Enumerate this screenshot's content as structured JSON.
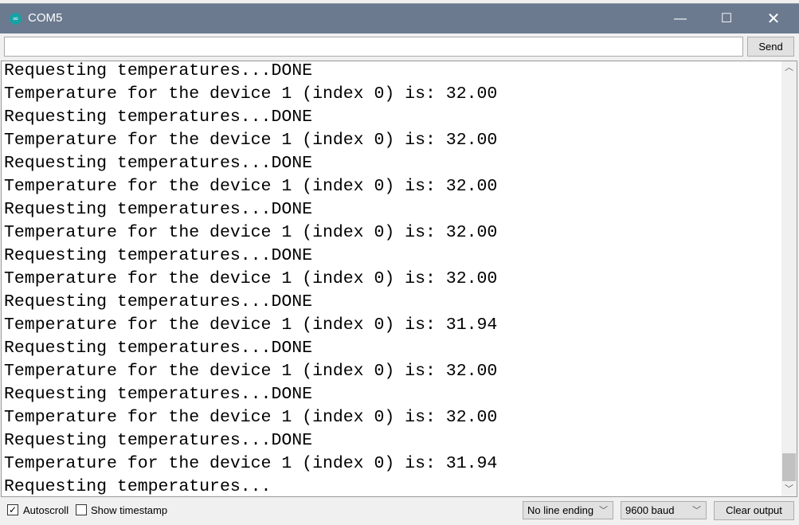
{
  "window": {
    "title": "COM5",
    "logo_icon": "arduino-infinity-icon",
    "title_bar_color": "#6b7a8f"
  },
  "input": {
    "value": "",
    "send_label": "Send"
  },
  "output": {
    "lines": [
      "Requesting temperatures...DONE",
      "Temperature for the device 1 (index 0) is: 32.00",
      "Requesting temperatures...DONE",
      "Temperature for the device 1 (index 0) is: 32.00",
      "Requesting temperatures...DONE",
      "Temperature for the device 1 (index 0) is: 32.00",
      "Requesting temperatures...DONE",
      "Temperature for the device 1 (index 0) is: 32.00",
      "Requesting temperatures...DONE",
      "Temperature for the device 1 (index 0) is: 32.00",
      "Requesting temperatures...DONE",
      "Temperature for the device 1 (index 0) is: 31.94",
      "Requesting temperatures...DONE",
      "Temperature for the device 1 (index 0) is: 32.00",
      "Requesting temperatures...DONE",
      "Temperature for the device 1 (index 0) is: 32.00",
      "Requesting temperatures...DONE",
      "Temperature for the device 1 (index 0) is: 31.94",
      "Requesting temperatures..."
    ]
  },
  "footer": {
    "autoscroll_label": "Autoscroll",
    "autoscroll_checked": true,
    "timestamp_label": "Show timestamp",
    "timestamp_checked": false,
    "line_ending": "No line ending",
    "baud": "9600 baud",
    "clear_label": "Clear output"
  }
}
